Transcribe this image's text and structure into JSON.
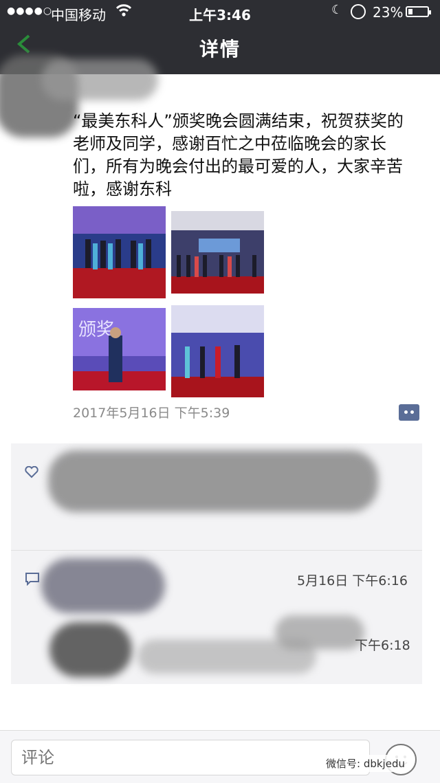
{
  "status_bar": {
    "signal": "●●●●○",
    "carrier": "中国移动",
    "time": "上午3:46",
    "battery_percent": "23%",
    "battery_level": 0.23
  },
  "nav": {
    "title": "详情"
  },
  "post": {
    "text": "“最美东科人”颁奖晚会圆满结束，祝贺获奖的老师及同学，感谢百忙之中莅临晚会的家长们，所有为晚会付出的最可爱的人，大家辛苦啦，感谢东科",
    "photos": [
      {
        "name": "award-photo-1"
      },
      {
        "name": "award-photo-2"
      },
      {
        "name": "award-photo-3"
      },
      {
        "name": "award-photo-4"
      }
    ],
    "timestamp": "2017年5月16日 下午5:39"
  },
  "comments": {
    "comment1_time": "5月16日 下午6:16",
    "comment2_time": "下午6:18"
  },
  "bottom": {
    "comment_placeholder": "评论",
    "watermark": "微信号: dbkjedu"
  },
  "colors": {
    "header_bg": "#2d2e33",
    "link_blue": "#5a6d97",
    "panel_bg": "#f3f3f5"
  }
}
